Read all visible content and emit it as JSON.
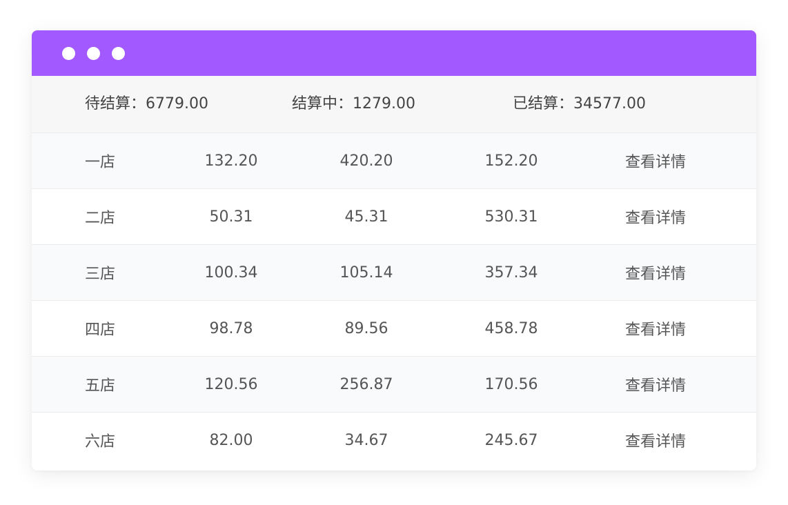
{
  "colors": {
    "titlebar": "#a259ff",
    "summary_bg": "#f7f7f7",
    "row_alt_bg": "#f9fafc",
    "text": "#555555"
  },
  "window": {
    "controls": [
      "dot",
      "dot",
      "dot"
    ]
  },
  "summary": {
    "pending": "待结算：6779.00",
    "settling": "结算中：1279.00",
    "settled": "已结算：34577.00"
  },
  "rows": [
    {
      "store": "一店",
      "v1": "132.20",
      "v2": "420.20",
      "v3": "152.20",
      "action": "查看详情"
    },
    {
      "store": "二店",
      "v1": "50.31",
      "v2": "45.31",
      "v3": "530.31",
      "action": "查看详情"
    },
    {
      "store": "三店",
      "v1": "100.34",
      "v2": "105.14",
      "v3": "357.34",
      "action": "查看详情"
    },
    {
      "store": "四店",
      "v1": "98.78",
      "v2": "89.56",
      "v3": "458.78",
      "action": "查看详情"
    },
    {
      "store": "五店",
      "v1": "120.56",
      "v2": "256.87",
      "v3": "170.56",
      "action": "查看详情"
    },
    {
      "store": "六店",
      "v1": "82.00",
      "v2": "34.67",
      "v3": "245.67",
      "action": "查看详情"
    }
  ]
}
